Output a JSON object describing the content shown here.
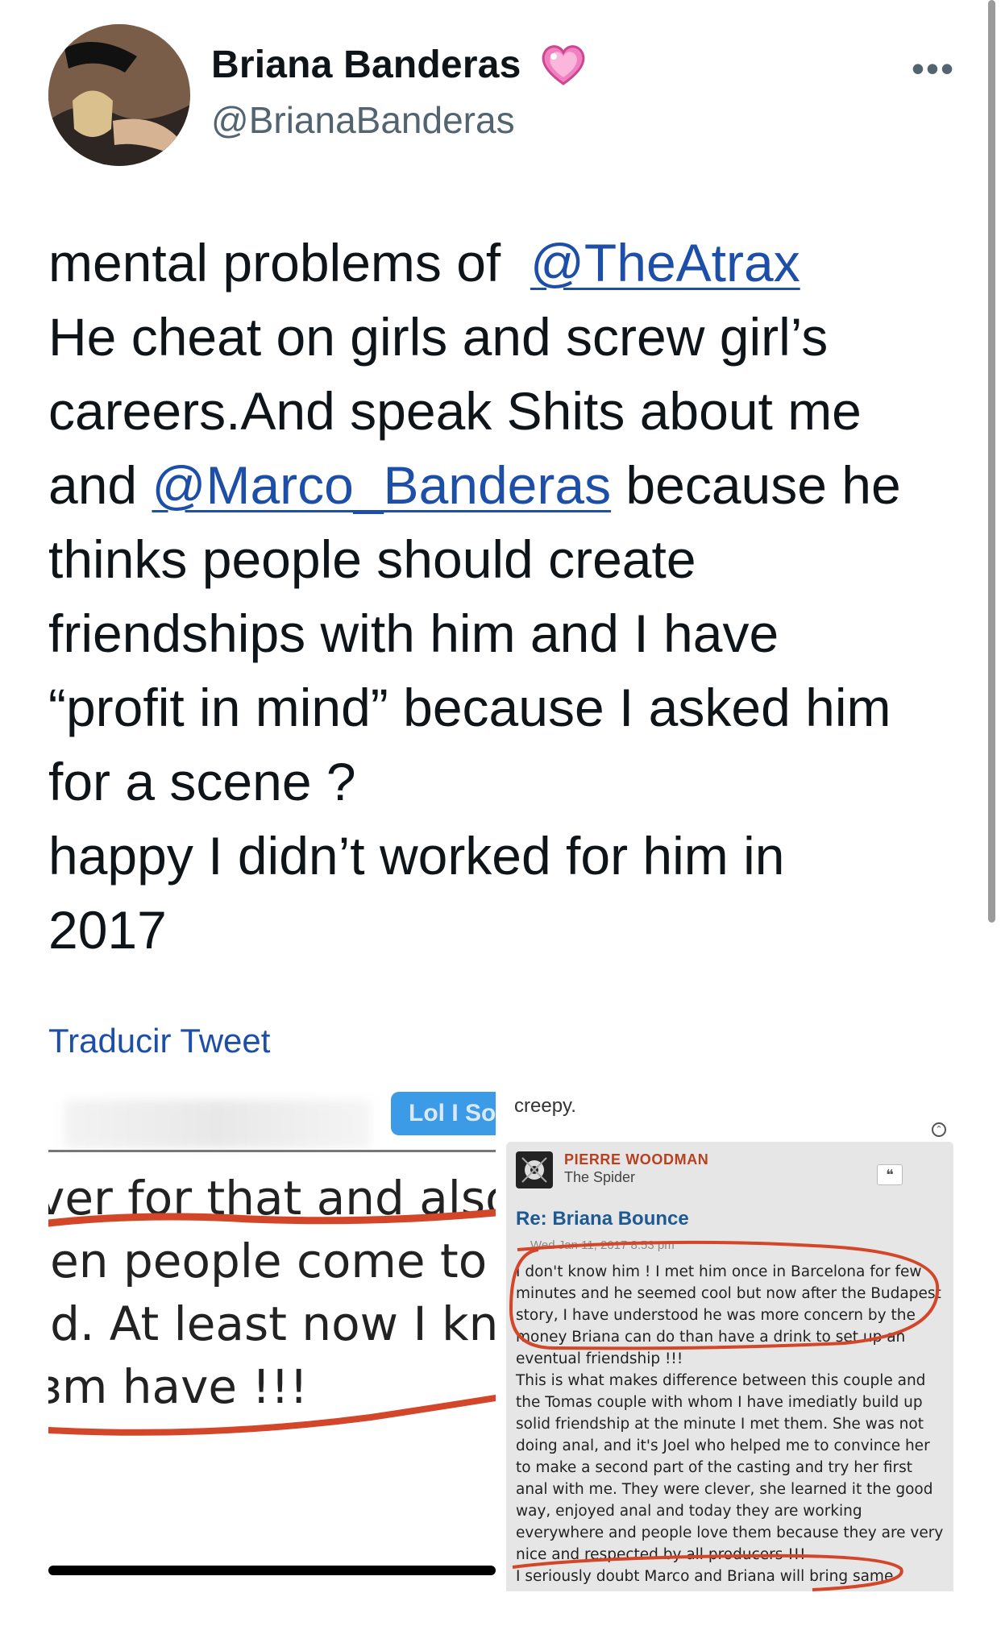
{
  "author": {
    "display_name": "Briana Banderas",
    "handle": "@BrianaBanderas",
    "badge_icon": "pink-heart-icon"
  },
  "menu": {
    "more_label": "•••"
  },
  "tweet": {
    "lines": [
      {
        "pre": "mental problems of  ",
        "mention": "@TheAtrax",
        "post": ""
      },
      {
        "pre": "He cheat on girls and screw girl’s",
        "mention": "",
        "post": ""
      },
      {
        "pre": "careers.And speak Shits about me",
        "mention": "",
        "post": ""
      },
      {
        "pre": "and ",
        "mention": "@Marco_Banderas",
        "post": " because he"
      },
      {
        "pre": "thinks people should create",
        "mention": "",
        "post": ""
      },
      {
        "pre": "friendships with him and I have",
        "mention": "",
        "post": ""
      },
      {
        "pre": "“profit in mind” because I asked him",
        "mention": "",
        "post": ""
      },
      {
        "pre": "for a scene ?",
        "mention": "",
        "post": ""
      },
      {
        "pre": "happy I didn’t worked for him in",
        "mention": "",
        "post": ""
      },
      {
        "pre": "2017",
        "mention": "",
        "post": ""
      }
    ],
    "link_color": "#1d4ea8"
  },
  "translate_label": "Traducir Tweet",
  "media_left": {
    "bubble_text": "Lol I So",
    "lines": [
      "ver for that and also t",
      "ıen people come to yo",
      "ıd. At least now I knov",
      "ɜm have !!!"
    ]
  },
  "media_right": {
    "header_text": "creepy.",
    "author": "PIERRE WOODMAN",
    "role": "The Spider",
    "quote_icon": "❝",
    "title": "Re: Briana Bounce",
    "date": "Wed Jan 11, 2017 8:53 pm",
    "body_lines": [
      "I don't know him ! I met him once in Barcelona for few",
      "minutes and he seemed cool but now after the Budapest",
      "story, I have understood he was more concern by the",
      "money Briana can do than have a drink to set up an",
      "eventual friendship !!!",
      "This is what makes difference between this couple and",
      "the Tomas couple with whom I have imediatly build up",
      "solid friendship at the minute I met them. She was not",
      "doing anal, and it's Joel who helped me to convince her",
      "to make a second part of the casting and try her first",
      "anal with me. They were clever, she learned it the good",
      "way, enjoyed anal and today they are working",
      "everywhere and people love them because they are very",
      "nice and respected by all producers !!!",
      "I seriously doubt Marco and Briana will bring same"
    ],
    "highlight_color": "#d4462a"
  }
}
